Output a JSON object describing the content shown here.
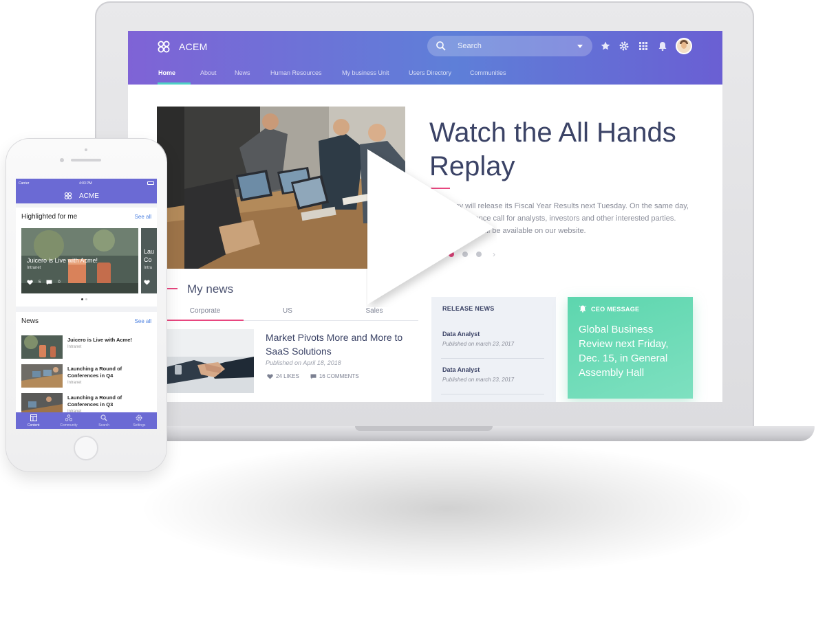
{
  "desktop": {
    "brand": "ACEM",
    "search_placeholder": "Search",
    "nav": [
      "Home",
      "About",
      "News",
      "Human Resources",
      "My business Unit",
      "Users Directory",
      "Communities"
    ],
    "hero": {
      "title": "Watch the All Hands Replay",
      "body": "Company will release its Fiscal Year Results next Tuesday. On the same day, host a conference call for analysts, investors and other interested parties. Analyst report will be available on our website."
    },
    "my_news": {
      "title": "My news",
      "tabs": [
        "Corporate",
        "US",
        "Sales"
      ],
      "article": {
        "title": "Market Pivots More and More to SaaS Solutions",
        "date": "Published on April 18, 2018",
        "likes": "24 LIKES",
        "comments": "16 COMMENTS"
      }
    },
    "release_news": {
      "title": "RELEASE NEWS",
      "items": [
        {
          "title": "Data Analyst",
          "date": "Published on march 23, 2017"
        },
        {
          "title": "Data Analyst",
          "date": "Published on march 23, 2017"
        }
      ]
    },
    "ceo_message": {
      "title": "CEO MESSAGE",
      "body": "Global Business Review next Friday, Dec. 15, in General Assembly Hall"
    },
    "colors": {
      "accent": "#e8467f",
      "nav_underline": "#4fd1c5",
      "ceo_card": "#5dd6ae",
      "text_dark": "#3b4366"
    }
  },
  "mobile": {
    "carrier": "Carrier",
    "time": "4:03 PM",
    "brand": "ACME",
    "highlighted": {
      "title": "Highlighted for me",
      "see_all": "See all",
      "card": {
        "title": "Juicero is Live with Acme!",
        "source": "Intranet",
        "likes": "5",
        "comments": "0"
      },
      "peek": {
        "title": "Lau Co",
        "source": "Intra"
      }
    },
    "news": {
      "title": "News",
      "see_all": "See all",
      "items": [
        {
          "title": "Juicero is Live with Acme!",
          "source": "Intranet"
        },
        {
          "title": "Launching a Round of Conferences in Q4",
          "source": "Intranet"
        },
        {
          "title": "Launching a Round of Conferences in Q3",
          "source": "Intranet"
        }
      ]
    },
    "tabbar": [
      "Content",
      "Community",
      "Search",
      "Settings"
    ]
  }
}
